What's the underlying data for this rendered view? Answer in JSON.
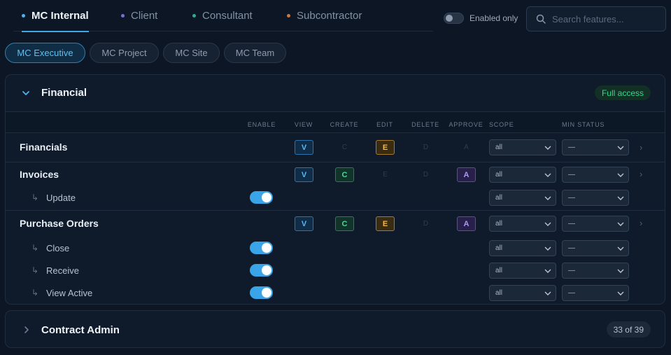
{
  "tabs": [
    {
      "label": "MC Internal",
      "dot_color": "#4fb3ef"
    },
    {
      "label": "Client",
      "dot_color": "#7a6fd6"
    },
    {
      "label": "Consultant",
      "dot_color": "#2fae8e"
    },
    {
      "label": "Subcontractor",
      "dot_color": "#c77a45"
    }
  ],
  "filter": {
    "enabled_only_label": "Enabled only"
  },
  "search": {
    "placeholder": "Search features..."
  },
  "roles": [
    "MC Executive",
    "MC Project",
    "MC Site",
    "MC Team"
  ],
  "columns": {
    "enable": "ENABLE",
    "view": "VIEW",
    "create": "CREATE",
    "edit": "EDIT",
    "delete": "DELETE",
    "approve": "APPROVE",
    "scope": "SCOPE",
    "min_status": "MIN STATUS"
  },
  "sections": [
    {
      "title": "Financial",
      "badge": "Full access",
      "rows": [
        {
          "name": "Financials",
          "perms": {
            "view": "V",
            "create": "C",
            "edit": "E",
            "delete": "D",
            "approve": "A"
          },
          "scope": "all",
          "min_status": "—",
          "arrow": "›"
        },
        {
          "name": "Invoices",
          "perms": {
            "view": "V",
            "create": "C",
            "edit": "E",
            "delete": "D",
            "approve": "A"
          },
          "scope": "all",
          "min_status": "—",
          "arrow": "›"
        },
        {
          "name": "Update",
          "arrow_sub": "↳",
          "scope": "all",
          "min_status": "—"
        },
        {
          "name": "Purchase Orders",
          "perms": {
            "view": "V",
            "create": "C",
            "edit": "E",
            "delete": "D",
            "approve": "A"
          },
          "scope": "all",
          "min_status": "—",
          "arrow": "›"
        },
        {
          "name": "Close",
          "arrow_sub": "↳",
          "scope": "all",
          "min_status": "—"
        },
        {
          "name": "Receive",
          "arrow_sub": "↳",
          "scope": "all",
          "min_status": "—"
        },
        {
          "name": "View Active",
          "arrow_sub": "↳",
          "scope": "all",
          "min_status": "—"
        }
      ]
    },
    {
      "title": "Contract Admin",
      "badge": "33 of 39"
    }
  ]
}
